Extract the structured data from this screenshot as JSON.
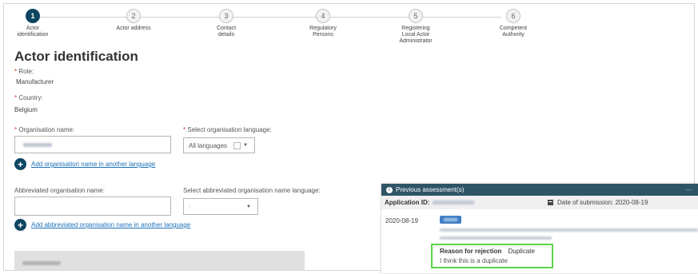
{
  "stepper": {
    "steps": [
      {
        "number": "1",
        "label": "Actor\nidentification",
        "active": true
      },
      {
        "number": "2",
        "label": "Actor address",
        "active": false
      },
      {
        "number": "3",
        "label": "Contact\ndetails",
        "active": false
      },
      {
        "number": "4",
        "label": "Regulatory\nPersons",
        "active": false
      },
      {
        "number": "5",
        "label": "Registering\nLocal Actor\nAdministrator",
        "active": false
      },
      {
        "number": "6",
        "label": "Competent\nAuthority",
        "active": false
      }
    ]
  },
  "page": {
    "title": "Actor identification"
  },
  "form": {
    "role_label": "Role:",
    "role_value": "Manufacturer",
    "country_label": "Country:",
    "country_value": "Belgium",
    "org_name_label": "Organisation name:",
    "org_lang_label": "Select organisation language:",
    "org_lang_value": "All languages",
    "add_org_name_link": "Add organisation name in another language",
    "abbr_name_label": "Abbreviated organisation name:",
    "abbr_lang_label": "Select abbreviated organisation name language:",
    "abbr_lang_value": "-",
    "add_abbr_name_link": "Add abbreviated organisation name in another language",
    "required_mark": "*"
  },
  "assessment": {
    "header": "Previous assessment(s)",
    "minimize": "—",
    "application_id_label": "Application ID:",
    "submission_label": "Date of submission: 2020-08-19",
    "date": "2020-08-19",
    "reason_label": "Reason for rejection",
    "reason_value": "Duplicate",
    "comment": "I think this is a duplicate"
  },
  "colors": {
    "primary": "#0e4561",
    "panel_header": "#2f5466",
    "highlight": "#5cd44a",
    "link": "#1d70b8",
    "required": "#d4351c"
  },
  "icons": {
    "info": "info-icon",
    "calendar": "calendar-icon",
    "plus": "plus-icon",
    "chevron": "chevron-down-icon"
  }
}
